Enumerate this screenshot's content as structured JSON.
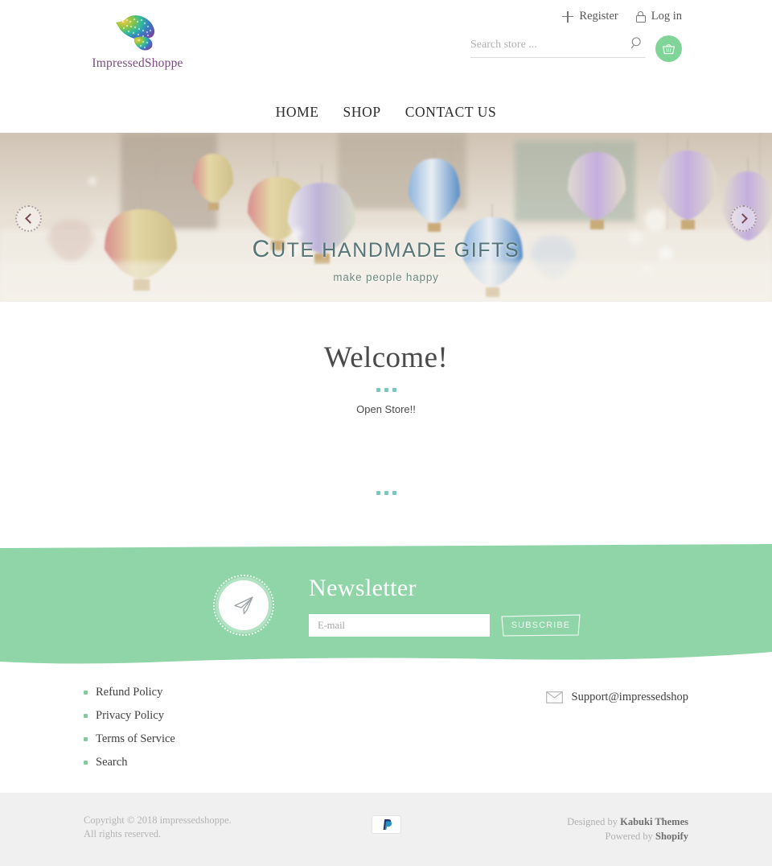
{
  "header": {
    "logo": {
      "brand": "ImpressedShoppe",
      "icon": "dove-logo-icon"
    },
    "register_label": "Register",
    "login_label": "Log in",
    "search": {
      "placeholder": "Search store ...",
      "value": ""
    },
    "cart_icon": "shopping-basket-icon"
  },
  "nav": {
    "items": [
      {
        "label": "HOME"
      },
      {
        "label": "SHOP"
      },
      {
        "label": "CONTACT US"
      }
    ]
  },
  "banner": {
    "caption_first": "C",
    "caption_rest": "ute handmade gifts",
    "subcaption": "make people happy",
    "prev_label": "previous slide",
    "next_label": "next slide"
  },
  "welcome": {
    "title": "Welcome!",
    "body": "Open Store!!"
  },
  "newsletter": {
    "title": "Newsletter",
    "email_placeholder": "E-mail",
    "email_value": "",
    "subscribe_label": "SUBSCRIBE",
    "icon": "paper-plane-icon",
    "bg_color": "#8fd5a7"
  },
  "footer": {
    "links": [
      {
        "label": "Refund Policy"
      },
      {
        "label": "Privacy Policy"
      },
      {
        "label": "Terms of Service"
      },
      {
        "label": "Search"
      }
    ],
    "email": "Support@impressedshop",
    "email_icon": "envelope-icon"
  },
  "bottom": {
    "copyright": "Copyright © 2018 impressedshoppe. All rights reserved.",
    "payment_icon": "paypal-icon",
    "designed_by_prefix": "Designed by ",
    "designed_by_name": "Kabuki Themes",
    "powered_by_prefix": "Powered by ",
    "powered_by_name": "Shopify"
  },
  "colors": {
    "accent_green": "#7fd497",
    "newsletter_green": "#8fd5a7",
    "logo_purple": "#7a4b7e",
    "dot_teal": "#7ec5bd"
  }
}
